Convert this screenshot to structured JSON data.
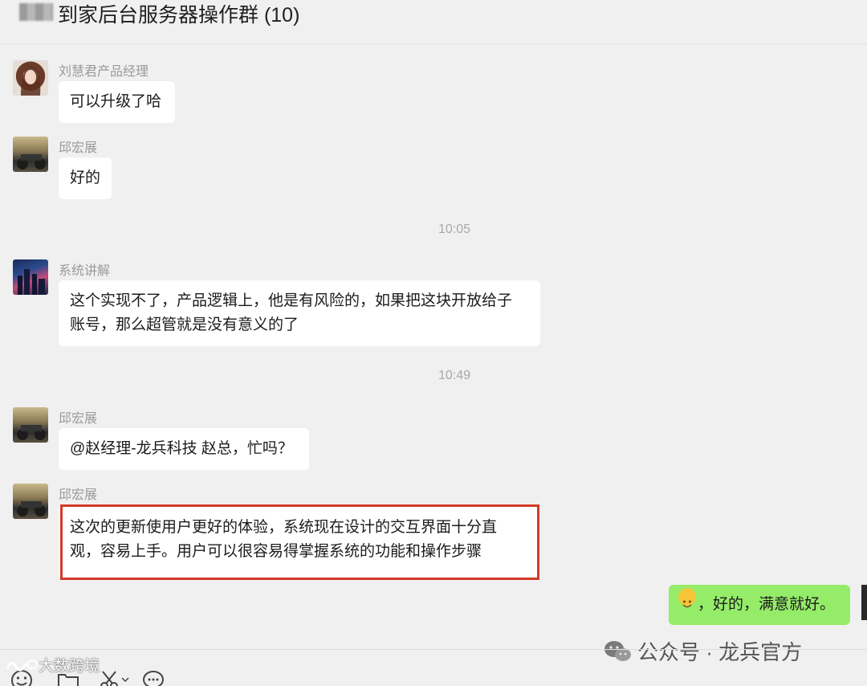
{
  "header": {
    "group_title": "到家后台服务器操作群 (10)"
  },
  "messages": [
    {
      "sender": "刘慧君产品经理",
      "text": "可以升级了哈",
      "avatar": "girl-portrait"
    },
    {
      "sender": "邱宏展",
      "text": "好的",
      "avatar": "motorcycle-photo"
    },
    {
      "timestamp": "10:05"
    },
    {
      "sender": "系统讲解",
      "lines": [
        "这个实现不了，产品逻辑上，他是有风险的，如果把这块开放给子",
        "账号，那么超管就是没有意义的了"
      ],
      "avatar": "city-night-photo"
    },
    {
      "timestamp": "10:49"
    },
    {
      "sender": "邱宏展",
      "text": "@赵经理-龙兵科技 赵总，忙吗？",
      "avatar": "motorcycle-photo"
    },
    {
      "sender": "邱宏展",
      "lines": [
        "这次的更新使用户更好的体验，系统现在设计的交互界面十分直",
        "观，容易上手。用户可以很容易得掌握系统的功能和操作步骤"
      ],
      "avatar": "motorcycle-photo",
      "highlighted": true
    }
  ],
  "self_message": {
    "emoji": "smile-emoji",
    "text": "，好的，满意就好。"
  },
  "toolbar": {
    "icons": [
      "emoji-icon",
      "folder-icon",
      "scissors-icon",
      "chat-bubble-icon"
    ]
  },
  "watermarks": {
    "left": "大数跨境",
    "right": "公众号 · 龙兵官方"
  },
  "colors": {
    "self_bubble": "#95ec69",
    "highlight_border": "#d23a2a",
    "background": "#f0f0f0"
  }
}
